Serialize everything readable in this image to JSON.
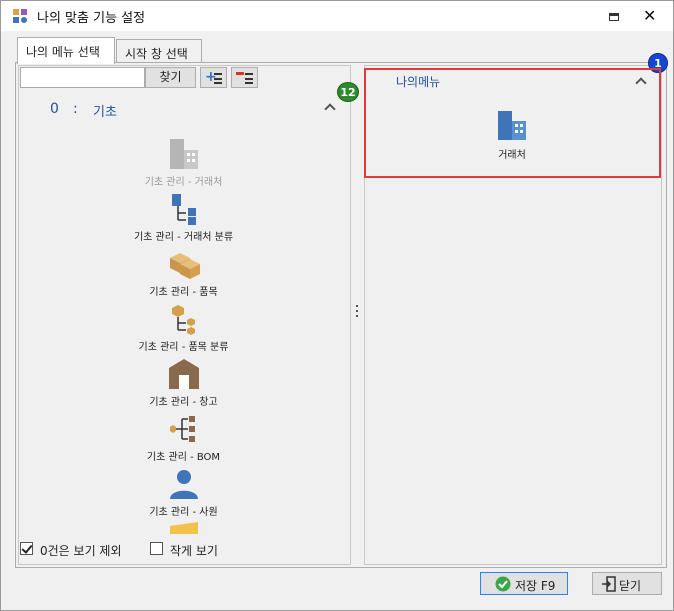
{
  "window": {
    "title": "나의 맞춤 기능 설정"
  },
  "tabs": [
    {
      "label": "나의 메뉴 선택",
      "active": true
    },
    {
      "label": "시작 창 선택",
      "active": false
    }
  ],
  "search": {
    "value": "",
    "button_label": "찾기"
  },
  "group": {
    "number": "0",
    "separator": ":",
    "name": "기초"
  },
  "menu_items": [
    {
      "label": "기초 관리 - 거래처",
      "icon": "building-icon",
      "disabled": true
    },
    {
      "label": "기초 관리 - 거래처 분류",
      "icon": "building-tree-icon",
      "disabled": false
    },
    {
      "label": "기초 관리 - 품목",
      "icon": "boxes-icon",
      "disabled": false
    },
    {
      "label": "기초 관리 - 품목 분류",
      "icon": "box-tree-icon",
      "disabled": false
    },
    {
      "label": "기초 관리 - 창고",
      "icon": "warehouse-icon",
      "disabled": false
    },
    {
      "label": "기초 관리 - BOM",
      "icon": "bom-tree-icon",
      "disabled": false
    },
    {
      "label": "기초 관리 - 사원",
      "icon": "person-icon",
      "disabled": false
    }
  ],
  "my_menu": {
    "title": "나의메뉴",
    "items": [
      {
        "label": "거래처",
        "icon": "building-icon"
      }
    ]
  },
  "badges": {
    "left": "12",
    "right": "1"
  },
  "options": {
    "exclude_zero_label": "0건은 보기 제외",
    "exclude_zero_checked": true,
    "small_view_label": "작게 보기",
    "small_view_checked": false
  },
  "footer": {
    "save_label": "저장 F9",
    "close_label": "닫기"
  },
  "colors": {
    "accent_blue": "#1f4f99",
    "highlight_red": "#e0393e",
    "icon_blue": "#3f74b8",
    "icon_gold": "#d4a04e",
    "icon_brown": "#8a6a4c"
  }
}
